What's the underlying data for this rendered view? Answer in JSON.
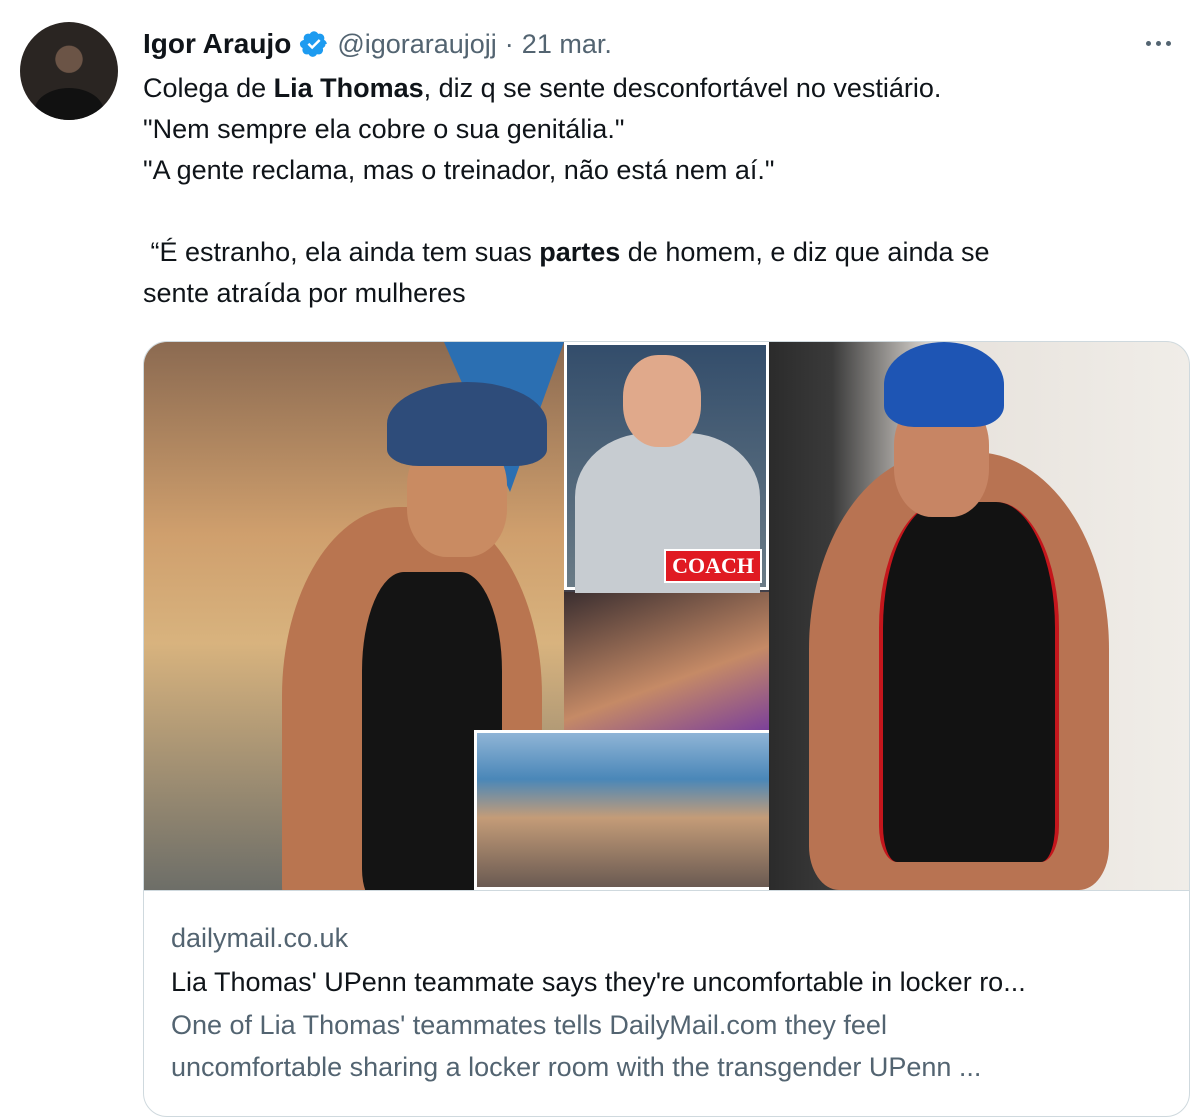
{
  "tweet": {
    "author_name": "Igor Araujo",
    "handle": "@igoraraujojj",
    "separator": "·",
    "date": "21 mar.",
    "text": {
      "line1_pre": "Colega de ",
      "line1_bold": "Lia Thomas",
      "line1_post": ", diz q se sente desconfortável no vestiário.",
      "line2": "\"Nem sempre ela cobre o sua genitália.\"",
      "line3": "\"A gente reclama, mas o treinador, não está nem aí.\"",
      "line4_pre": " “É estranho, ela ainda tem suas ",
      "line4_bold": "partes",
      "line4_post": " de homem, e diz que ainda se",
      "line5": "sente atraída por mulheres"
    }
  },
  "card": {
    "image_label": "COACH",
    "domain": "dailymail.co.uk",
    "title": "Lia Thomas' UPenn teammate says they're uncomfortable in locker ro...",
    "description_line1": "One of Lia Thomas' teammates tells DailyMail.com they feel",
    "description_line2": "uncomfortable sharing a locker room with the transgender UPenn ..."
  },
  "icons": {
    "verified": "verified-badge-icon",
    "more": "more-options-icon"
  },
  "colors": {
    "text_primary": "#0f1419",
    "text_secondary": "#536471",
    "verified_blue": "#1d9bf0",
    "border": "#cfd9de"
  }
}
